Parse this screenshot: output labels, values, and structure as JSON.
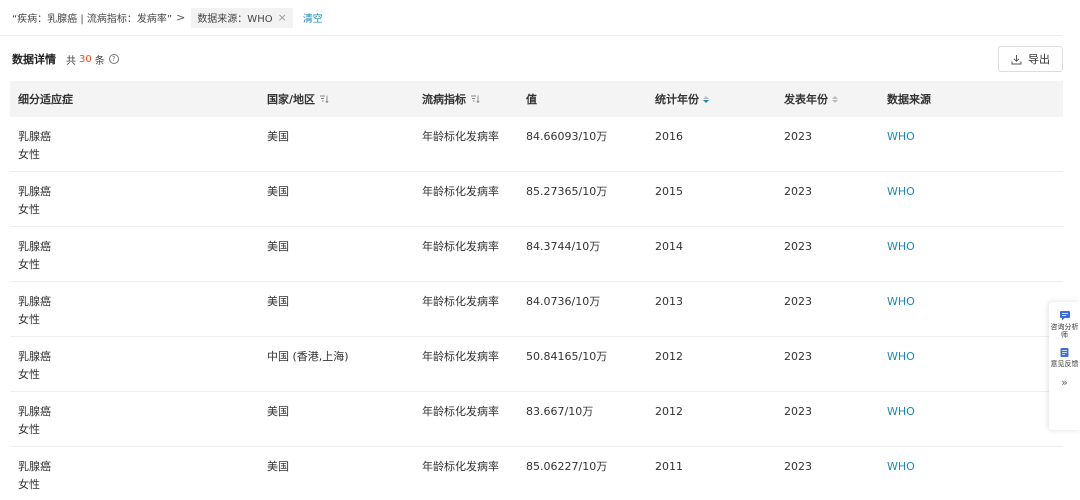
{
  "filter": {
    "query": "“疾病：乳腺癌 | 流病指标：发病率”",
    "separator": ">",
    "tag": "数据来源：WHO",
    "tag_close": "×",
    "clear": "清空"
  },
  "section": {
    "title": "数据详情",
    "count_prefix": "共",
    "count": "30",
    "count_suffix": "条",
    "help": "?"
  },
  "export_label": "导出",
  "columns": [
    "细分适应症",
    "国家/地区",
    "流病指标",
    "值",
    "统计年份",
    "发表年份",
    "数据来源"
  ],
  "rows": [
    {
      "sub1": "乳腺癌",
      "sub2": "女性",
      "country": "美国",
      "indicator": "年龄标化发病率",
      "value": "84.66093/10万",
      "stat_year": "2016",
      "pub_year": "2023",
      "source": "WHO"
    },
    {
      "sub1": "乳腺癌",
      "sub2": "女性",
      "country": "美国",
      "indicator": "年龄标化发病率",
      "value": "85.27365/10万",
      "stat_year": "2015",
      "pub_year": "2023",
      "source": "WHO"
    },
    {
      "sub1": "乳腺癌",
      "sub2": "女性",
      "country": "美国",
      "indicator": "年龄标化发病率",
      "value": "84.3744/10万",
      "stat_year": "2014",
      "pub_year": "2023",
      "source": "WHO"
    },
    {
      "sub1": "乳腺癌",
      "sub2": "女性",
      "country": "美国",
      "indicator": "年龄标化发病率",
      "value": "84.0736/10万",
      "stat_year": "2013",
      "pub_year": "2023",
      "source": "WHO"
    },
    {
      "sub1": "乳腺癌",
      "sub2": "女性",
      "country": "中国 (香港,上海)",
      "indicator": "年龄标化发病率",
      "value": "50.84165/10万",
      "stat_year": "2012",
      "pub_year": "2023",
      "source": "WHO"
    },
    {
      "sub1": "乳腺癌",
      "sub2": "女性",
      "country": "美国",
      "indicator": "年龄标化发病率",
      "value": "83.667/10万",
      "stat_year": "2012",
      "pub_year": "2023",
      "source": "WHO"
    },
    {
      "sub1": "乳腺癌",
      "sub2": "女性",
      "country": "美国",
      "indicator": "年龄标化发病率",
      "value": "85.06227/10万",
      "stat_year": "2011",
      "pub_year": "2023",
      "source": "WHO"
    }
  ],
  "side": {
    "consult": "咨询分析师",
    "feedback": "意见反馈",
    "collapse": "»"
  },
  "colors": {
    "accent": "#1a8ab8",
    "count": "#e8501e",
    "header_bg": "#f4f4f4"
  },
  "icons": [
    "close-icon",
    "help-icon",
    "download-icon",
    "filter-icon",
    "sort-icon",
    "chat-icon",
    "feedback-icon",
    "double-chevron-right-icon"
  ]
}
